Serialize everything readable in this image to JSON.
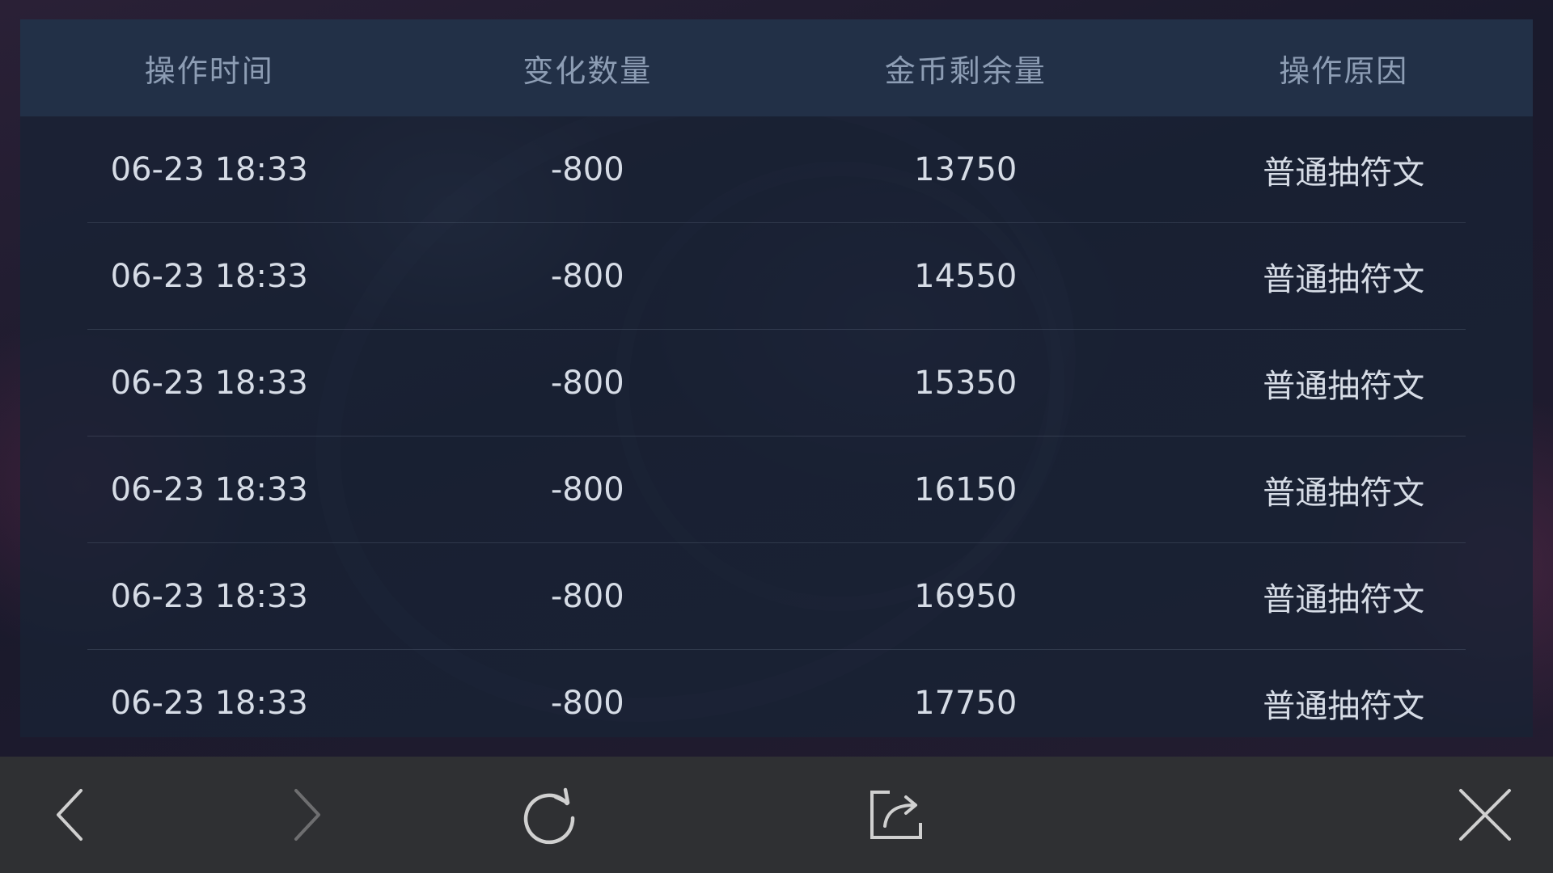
{
  "table": {
    "headers": [
      "操作时间",
      "变化数量",
      "金币剩余量",
      "操作原因"
    ],
    "rows": [
      {
        "time": "06-23 18:33",
        "change": "-800",
        "remaining": "13750",
        "reason": "普通抽符文"
      },
      {
        "time": "06-23 18:33",
        "change": "-800",
        "remaining": "14550",
        "reason": "普通抽符文"
      },
      {
        "time": "06-23 18:33",
        "change": "-800",
        "remaining": "15350",
        "reason": "普通抽符文"
      },
      {
        "time": "06-23 18:33",
        "change": "-800",
        "remaining": "16150",
        "reason": "普通抽符文"
      },
      {
        "time": "06-23 18:33",
        "change": "-800",
        "remaining": "16950",
        "reason": "普通抽符文"
      },
      {
        "time": "06-23 18:33",
        "change": "-800",
        "remaining": "17750",
        "reason": "普通抽符文"
      }
    ]
  },
  "toolbar": {
    "icons": {
      "back": "chevron-left-icon",
      "forward": "chevron-right-icon",
      "refresh": "refresh-icon",
      "share": "share-icon",
      "close": "close-icon"
    },
    "forward_enabled": false
  },
  "colors": {
    "header_bg": "#223047",
    "header_text": "#8d9db4",
    "cell_text": "#d6dce6",
    "toolbar_bg": "#2f3033",
    "icon_active": "#d0d0d0",
    "icon_disabled": "#6e6e70"
  }
}
